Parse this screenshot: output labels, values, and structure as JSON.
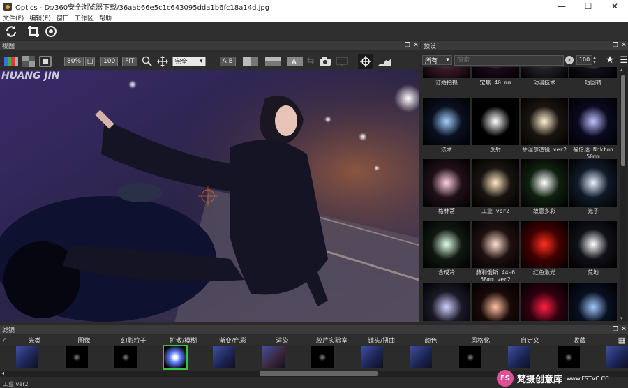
{
  "window": {
    "title": "Optics - D:/360安全浏览器下载/36aab66e5c1c643095dda1b6fc18a14d.jpg",
    "minimize": "—",
    "maximize": "☐",
    "close": "✕"
  },
  "menu": [
    "文件(F)",
    "编辑(E)",
    "窗口",
    "工作区",
    "帮助"
  ],
  "toolbar": {
    "icons": [
      "refresh-icon",
      "crop-icon",
      "target-icon"
    ]
  },
  "view_panel": {
    "title": "视图",
    "zoom": "80%",
    "btn_100": "100",
    "btn_fit": "FIT",
    "mode_select": "完全",
    "btn_ab": "A B",
    "image_text": "HUANG JIN"
  },
  "presets_panel": {
    "title": "预设",
    "filter_select": "所有",
    "search_placeholder": "搜索",
    "size_value": "100",
    "items": [
      {
        "label": "订婚拍摄"
      },
      {
        "label": "定焦 40 mm"
      },
      {
        "label": "动漫技术"
      },
      {
        "label": "短回转"
      },
      {
        "label": "法术"
      },
      {
        "label": "反射"
      },
      {
        "label": "菲涅尔透镜 ver2"
      },
      {
        "label": "福伦达 Nokton 50mm"
      },
      {
        "label": "格林蒂"
      },
      {
        "label": "工业 ver2"
      },
      {
        "label": "故意多彩"
      },
      {
        "label": "光子"
      },
      {
        "label": "合成冷"
      },
      {
        "label": "赫利俄斯 44-6 58mm ver2"
      },
      {
        "label": "红色激光"
      },
      {
        "label": "荒地"
      },
      {
        "label": ""
      },
      {
        "label": ""
      },
      {
        "label": ""
      },
      {
        "label": ""
      }
    ]
  },
  "filters_panel": {
    "title": "滤镜",
    "tabs": [
      "光类",
      "图像",
      "幻影粒子",
      "扩散/模糊",
      "渐变/色彩",
      "渲染",
      "胶片实验室",
      "镜头/扭曲",
      "颜色",
      "风格化",
      "自定义",
      "收藏"
    ]
  },
  "status": {
    "text": "工业 ver2"
  },
  "watermark": {
    "logo": "FS",
    "name": "梵摄创意库",
    "url": "www.FSTVC.CC"
  }
}
